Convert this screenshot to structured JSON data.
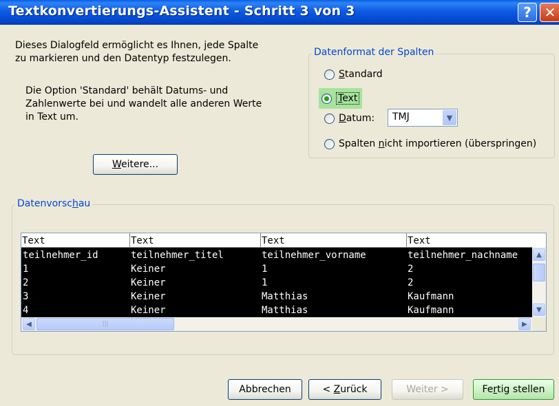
{
  "window": {
    "title": "Textkonvertierungs-Assistent - Schritt 3 von 3",
    "help_label": "?",
    "close_label": "✕"
  },
  "intro": {
    "line1": "Dieses Dialogfeld ermöglicht es Ihnen, jede Spalte",
    "line2": "zu markieren und den Datentyp festzulegen."
  },
  "info": {
    "line1": "Die Option 'Standard' behält Datums- und",
    "line2": "Zahlenwerte bei und wandelt alle anderen Werte",
    "line3": "in Text um."
  },
  "advanced_button": {
    "pre": "",
    "mnemonic": "W",
    "post": "eitere..."
  },
  "format_group": {
    "title": "Datenformat der Spalten",
    "standard": {
      "pre": "",
      "mnemonic": "S",
      "post": "tandard",
      "checked": false
    },
    "text": {
      "pre": "",
      "mnemonic": "T",
      "post": "ext",
      "checked": true
    },
    "datum": {
      "pre": "",
      "mnemonic": "D",
      "post": "atum:",
      "checked": false,
      "combo_value": "TMJ"
    },
    "skip": {
      "pre": "Spalten ",
      "mnemonic": "n",
      "post": "icht importieren (überspringen)",
      "checked": false
    }
  },
  "preview_group": {
    "title_pre": "Datenvorsc",
    "title_mnemonic": "h",
    "title_post": "au"
  },
  "preview_table": {
    "header": [
      "Text",
      "Text",
      "Text",
      "Text"
    ],
    "rows": [
      [
        "teilnehmer_id",
        "teilnehmer_titel",
        "teilnehmer_vorname",
        "teilnehmer_nachname"
      ],
      [
        "1",
        "Keiner",
        "1",
        "2"
      ],
      [
        "2",
        "Keiner",
        "1",
        "2"
      ],
      [
        "3",
        "Keiner",
        "Matthias",
        "Kaufmann"
      ],
      [
        "4",
        "Keiner",
        "Matthias",
        "Kaufmann"
      ]
    ]
  },
  "footer": {
    "cancel": "Abbrechen",
    "back": {
      "pre": "< ",
      "mnemonic": "Z",
      "post": "urück"
    },
    "next": "Weiter >",
    "finish": {
      "pre": "Fe",
      "mnemonic": "r",
      "post": "tig stellen"
    }
  },
  "colors": {
    "title_blue": "#0a5ee8",
    "group_title": "#0046d5",
    "highlight_green": "#a6e39c",
    "dialog_bg": "#ece9d8"
  }
}
